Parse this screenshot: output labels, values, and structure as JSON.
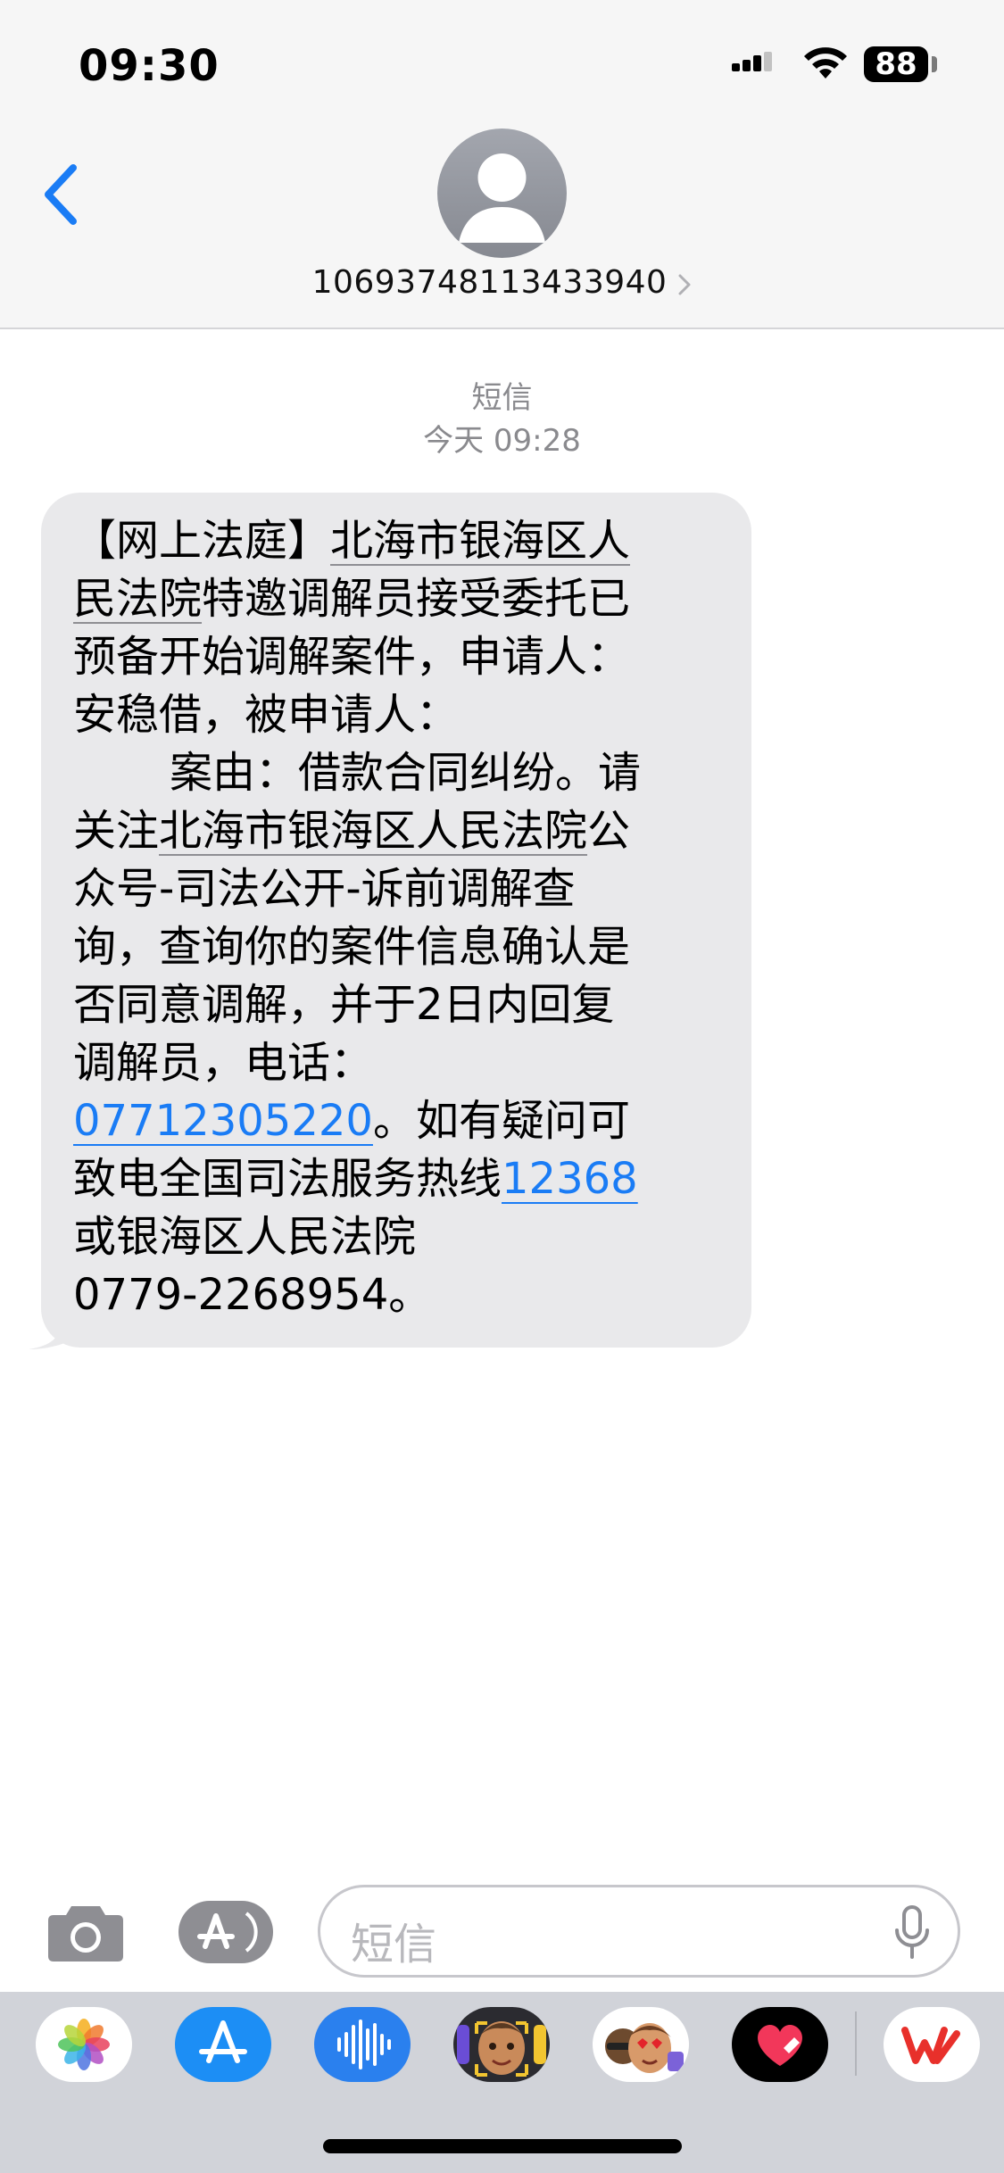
{
  "status_bar": {
    "time": "09:30",
    "battery": "88"
  },
  "header": {
    "contact_number": "10693748113433940",
    "icons": [
      "back-chevron-icon",
      "person-icon",
      "chevron-right-icon"
    ]
  },
  "conversation": {
    "service_label": "短信",
    "timestamp": "今天 09:28",
    "message": {
      "line1": "【网上法庭】",
      "line1_link": "北海市银海区人",
      "line2_link": "民法院",
      "line2": "特邀调解员接受委托已",
      "line3": "预备开始调解案件，申请人：",
      "line4": "安稳借，被申请人：",
      "line5": "案由：借款合同纠纷。请",
      "line6_pre": "关注",
      "line6_link": "北海市银海区人民法院",
      "line6_post": "公",
      "line7": "众号-司法公开-诉前调解查",
      "line8": "询，查询你的案件信息确认是",
      "line9": "否同意调解，并于2日内回复",
      "line10": "调解员，电话：",
      "phone_link": "07712305220",
      "line11_post": "。如有疑问可",
      "line12_pre": "致电全国司法服务热线",
      "hotline_link": "12368",
      "line13": "或银海区人民法院",
      "line14": "0779-2268954。"
    }
  },
  "input_bar": {
    "placeholder": "短信",
    "icons": [
      "camera-icon",
      "app-store-icon",
      "microphone-icon"
    ]
  },
  "app_tray": {
    "apps": [
      "photos-app-icon",
      "app-store-app-icon",
      "audio-message-app-icon",
      "memoji-app-icon",
      "memoji-stickers-app-icon",
      "digital-touch-app-icon",
      "wps-app-icon"
    ]
  },
  "colors": {
    "accent": "#1a7cf5",
    "bubble": "#e9e9eb",
    "header_bg": "#f6f6f6",
    "tray_bg": "#d1d3d9"
  }
}
